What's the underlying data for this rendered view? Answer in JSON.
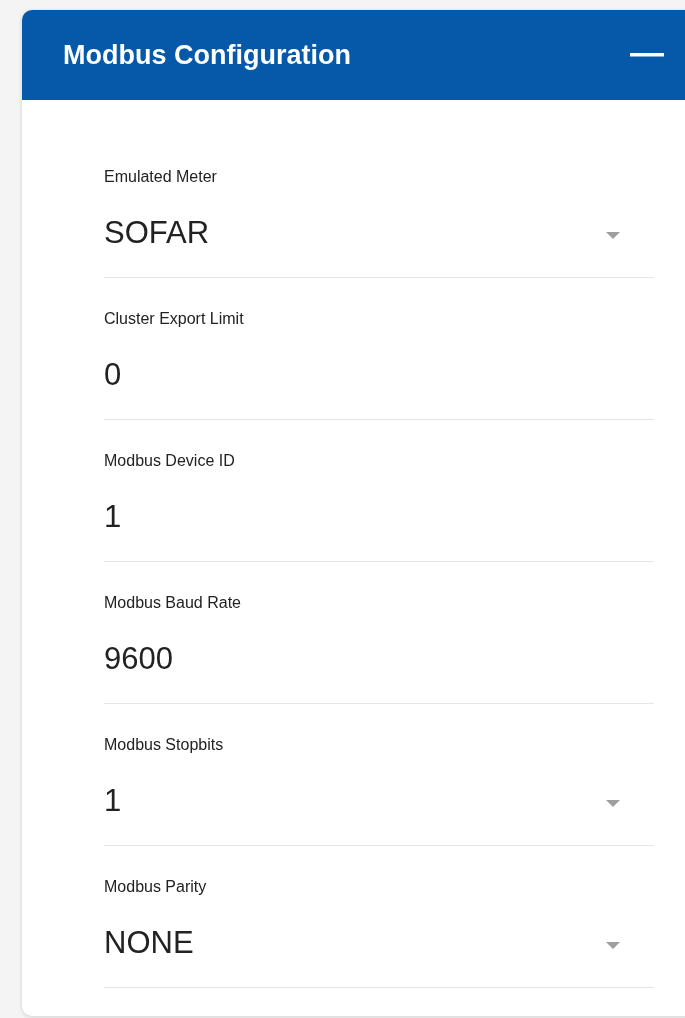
{
  "panel": {
    "title": "Modbus Configuration",
    "expanded": true
  },
  "fields": [
    {
      "label": "Emulated Meter",
      "kind": "select",
      "value": "SOFAR"
    },
    {
      "label": "Cluster Export Limit",
      "kind": "input",
      "value": "0"
    },
    {
      "label": "Modbus Device ID",
      "kind": "input",
      "value": "1"
    },
    {
      "label": "Modbus Baud Rate",
      "kind": "input",
      "value": "9600"
    },
    {
      "label": "Modbus Stopbits",
      "kind": "select",
      "value": "1"
    },
    {
      "label": "Modbus Parity",
      "kind": "select",
      "value": "NONE"
    }
  ]
}
